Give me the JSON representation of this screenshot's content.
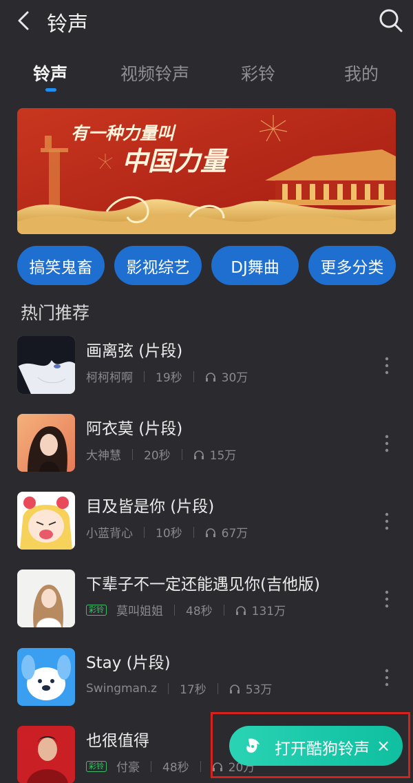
{
  "header": {
    "title": "铃声"
  },
  "tabs": [
    {
      "label": "铃声"
    },
    {
      "label": "视频铃声"
    },
    {
      "label": "彩铃"
    },
    {
      "label": "我的"
    }
  ],
  "banner": {
    "line1": "有一种力量叫",
    "line2": "中国力量"
  },
  "chips": [
    {
      "label": "搞笑鬼畜"
    },
    {
      "label": "影视综艺"
    },
    {
      "label": "DJ舞曲"
    },
    {
      "label": "更多分类"
    }
  ],
  "section_title": "热门推荐",
  "songs": [
    {
      "title": "画离弦 (片段)",
      "artist": "柯柯柯啊",
      "duration": "19秒",
      "plays": "30万"
    },
    {
      "title": "阿衣莫 (片段)",
      "artist": "大神慧",
      "duration": "20秒",
      "plays": "15万"
    },
    {
      "title": "目及皆是你 (片段)",
      "artist": "小蓝背心",
      "duration": "10秒",
      "plays": "67万"
    },
    {
      "title": "下辈子不一定还能遇见你(吉他版)",
      "badge": "彩铃",
      "artist": "莫叫姐姐",
      "duration": "48秒",
      "plays": "131万"
    },
    {
      "title": "Stay (片段)",
      "artist": "Swingman.z",
      "duration": "17秒",
      "plays": "53万"
    },
    {
      "title": "也很值得",
      "badge": "彩铃",
      "artist": "付豪",
      "duration": "48秒",
      "plays": "20万"
    }
  ],
  "open_app": {
    "label": "打开酷狗铃声",
    "close": "×"
  },
  "colors": {
    "accent": "#1f8ef0",
    "chip": "#1e6fcf",
    "open_button": "#1fcfae",
    "highlight_box": "#d4221c"
  }
}
